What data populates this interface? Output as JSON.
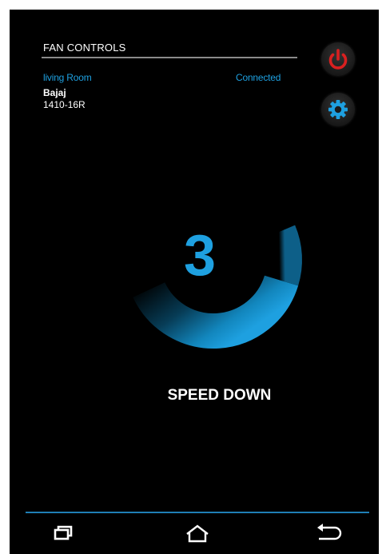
{
  "header": {
    "title": "FAN CONTROLS"
  },
  "device_info": {
    "room": "living Room",
    "status": "Connected",
    "brand": "Bajaj",
    "model": "1410-16R"
  },
  "controls": {
    "power_icon": "power-icon",
    "settings_icon": "gear-icon"
  },
  "speed": {
    "value": "3",
    "level_fraction": 0.6
  },
  "action": {
    "label": "SPEED DOWN"
  },
  "nav": {
    "recent_icon": "recent-apps-icon",
    "home_icon": "home-icon",
    "back_icon": "back-icon"
  },
  "colors": {
    "accent": "#1ea0e0",
    "power": "#d92020",
    "background": "#000000"
  }
}
